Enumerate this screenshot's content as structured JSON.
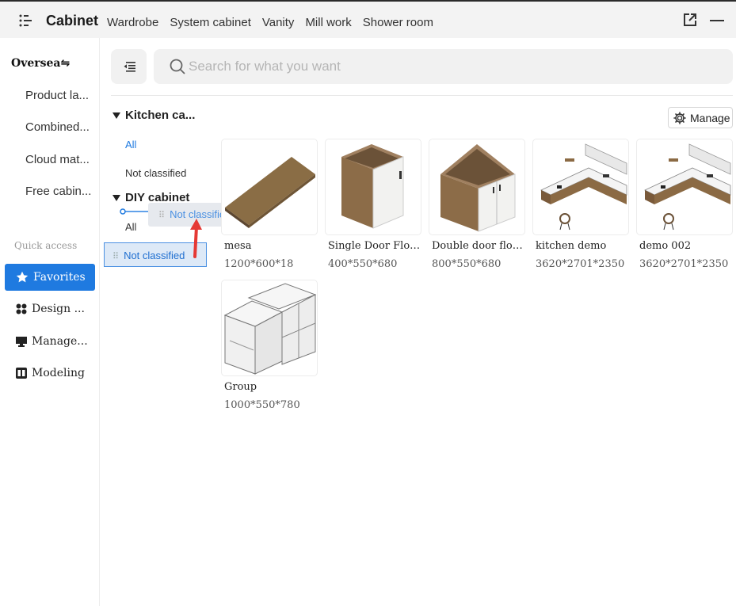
{
  "header": {
    "title": "Cabinet",
    "tabs": [
      "Wardrobe",
      "System cabinet",
      "Vanity",
      "Mill work",
      "Shower room"
    ]
  },
  "sidebar": {
    "region": "Oversea",
    "items": [
      "Product la...",
      "Combined...",
      "Cloud mat...",
      "Free cabin..."
    ],
    "quick_access_label": "Quick access",
    "nav": [
      {
        "label": "Favorites",
        "icon": "star-icon",
        "active": true
      },
      {
        "label": "Design ...",
        "icon": "design-icon",
        "active": false
      },
      {
        "label": "Manage...",
        "icon": "monitor-icon",
        "active": false
      },
      {
        "label": "Modeling",
        "icon": "modeling-icon",
        "active": false
      }
    ]
  },
  "search": {
    "placeholder": "Search for what you want"
  },
  "categories": {
    "group1": {
      "title": "Kitchen ca...",
      "items": [
        "All",
        "Not classified"
      ]
    },
    "group2": {
      "title": "DIY cabinet",
      "items": [
        "All"
      ]
    }
  },
  "drag": {
    "ghost_label": "Not classified",
    "item_label": "Not classified",
    "annotation": "move"
  },
  "manage_label": "Manage",
  "products": [
    {
      "name": "mesa",
      "size": "1200*600*18"
    },
    {
      "name": "Single Door Floor ...",
      "size": "400*550*680"
    },
    {
      "name": "Double door floor c...",
      "size": "800*550*680"
    },
    {
      "name": "kitchen demo",
      "size": "3620*2701*2350"
    },
    {
      "name": "demo 002",
      "size": "3620*2701*2350"
    },
    {
      "name": "Group",
      "size": "1000*550*780"
    }
  ],
  "colors": {
    "accent": "#1f7ae0",
    "annotation": "#e53935"
  }
}
